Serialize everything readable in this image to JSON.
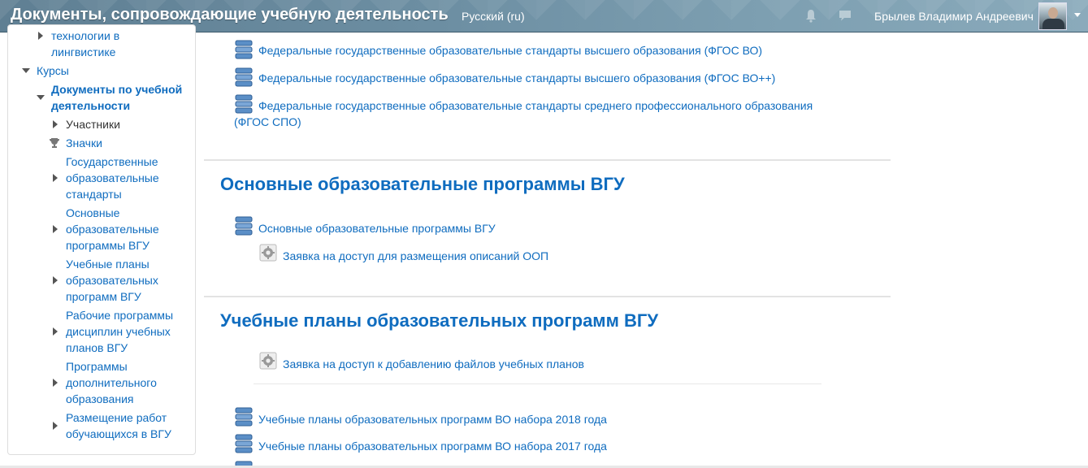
{
  "header": {
    "site_title": "Документы, сопровождающие учебную деятельность",
    "language": "Русский (ru)",
    "user_name": "Брылев Владимир Андреевич"
  },
  "sidebar": {
    "items": [
      {
        "label_lines": [
          "технологии в",
          "лингвистике"
        ]
      },
      {
        "label": "Курсы"
      },
      {
        "label_lines": [
          "Документы по учебной",
          "деятельности"
        ]
      },
      {
        "label": "Участники"
      },
      {
        "label": "Значки"
      },
      {
        "label_lines": [
          "Государственные",
          "образовательные",
          "стандарты"
        ]
      },
      {
        "label_lines": [
          "Основные",
          "образовательные",
          "программы ВГУ"
        ]
      },
      {
        "label_lines": [
          "Учебные планы",
          "образовательных",
          "программ ВГУ"
        ]
      },
      {
        "label_lines": [
          "Рабочие программы",
          "дисциплин учебных",
          "планов ВГУ"
        ]
      },
      {
        "label_lines": [
          "Программы",
          "дополнительного",
          "образования"
        ]
      },
      {
        "label_lines": [
          "Размещение работ",
          "обучающихся в ВГУ"
        ]
      }
    ]
  },
  "main": {
    "standards_links": [
      "Федеральные государственные образовательные стандарты высшего образования (ФГОС ВО)",
      "Федеральные государственные образовательные стандарты высшего образования (ФГОС ВО++)",
      "Федеральные государственные образовательные стандарты среднего профессионального образования",
      "(ФГОС СПО)"
    ],
    "section_oop": {
      "title": "Основные образовательные программы ВГУ",
      "book_link": "Основные образовательные программы ВГУ",
      "request_link": "Заявка на доступ для размещения описаний ООП"
    },
    "section_plans": {
      "title": "Учебные планы образовательных программ ВГУ",
      "request_link": "Заявка на доступ к добавлению файлов учебных планов",
      "links": [
        "Учебные планы образовательных программ ВО набора 2018 года",
        "Учебные планы образовательных программ ВО набора 2017 года"
      ]
    }
  }
}
